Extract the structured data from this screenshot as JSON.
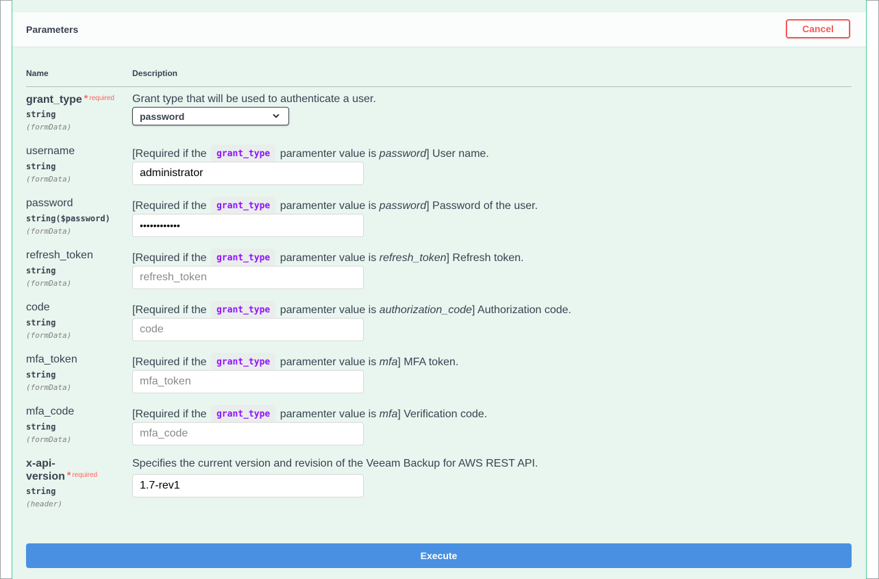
{
  "section": {
    "title": "Parameters",
    "cancel_label": "Cancel"
  },
  "columns": {
    "name": "Name",
    "description": "Description"
  },
  "common": {
    "required_label": "required",
    "required_star": "*",
    "chip": "grant_type",
    "req_prefix": "[Required if the",
    "req_mid": "paramenter value is"
  },
  "params": {
    "grant_type": {
      "name": "grant_type",
      "type": "string",
      "in": "(formData)",
      "description": "Grant type that will be used to authenticate a user.",
      "selected": "password"
    },
    "username": {
      "name": "username",
      "type": "string",
      "in": "(formData)",
      "cond": "password",
      "desc_tail": "] User name.",
      "value": "administrator"
    },
    "password": {
      "name": "password",
      "type": "string($password)",
      "in": "(formData)",
      "cond": "password",
      "desc_tail": "] Password of the user.",
      "value": "••••••••••••"
    },
    "refresh_token": {
      "name": "refresh_token",
      "type": "string",
      "in": "(formData)",
      "cond": "refresh_token",
      "desc_tail": "] Refresh token.",
      "placeholder": "refresh_token"
    },
    "code": {
      "name": "code",
      "type": "string",
      "in": "(formData)",
      "cond": "authorization_code",
      "desc_tail": "] Authorization code.",
      "placeholder": "code"
    },
    "mfa_token": {
      "name": "mfa_token",
      "type": "string",
      "in": "(formData)",
      "cond": "mfa",
      "desc_tail": "] MFA token.",
      "placeholder": "mfa_token"
    },
    "mfa_code": {
      "name": "mfa_code",
      "type": "string",
      "in": "(formData)",
      "cond": "mfa",
      "desc_tail": "] Verification code.",
      "placeholder": "mfa_code"
    },
    "x_api_version": {
      "name_line1": "x-api-",
      "name_line2": "version",
      "type": "string",
      "in": "(header)",
      "description": "Specifies the current version and revision of the Veeam Backup for AWS REST API.",
      "value": "1.7-rev1"
    }
  },
  "execute_label": "Execute"
}
